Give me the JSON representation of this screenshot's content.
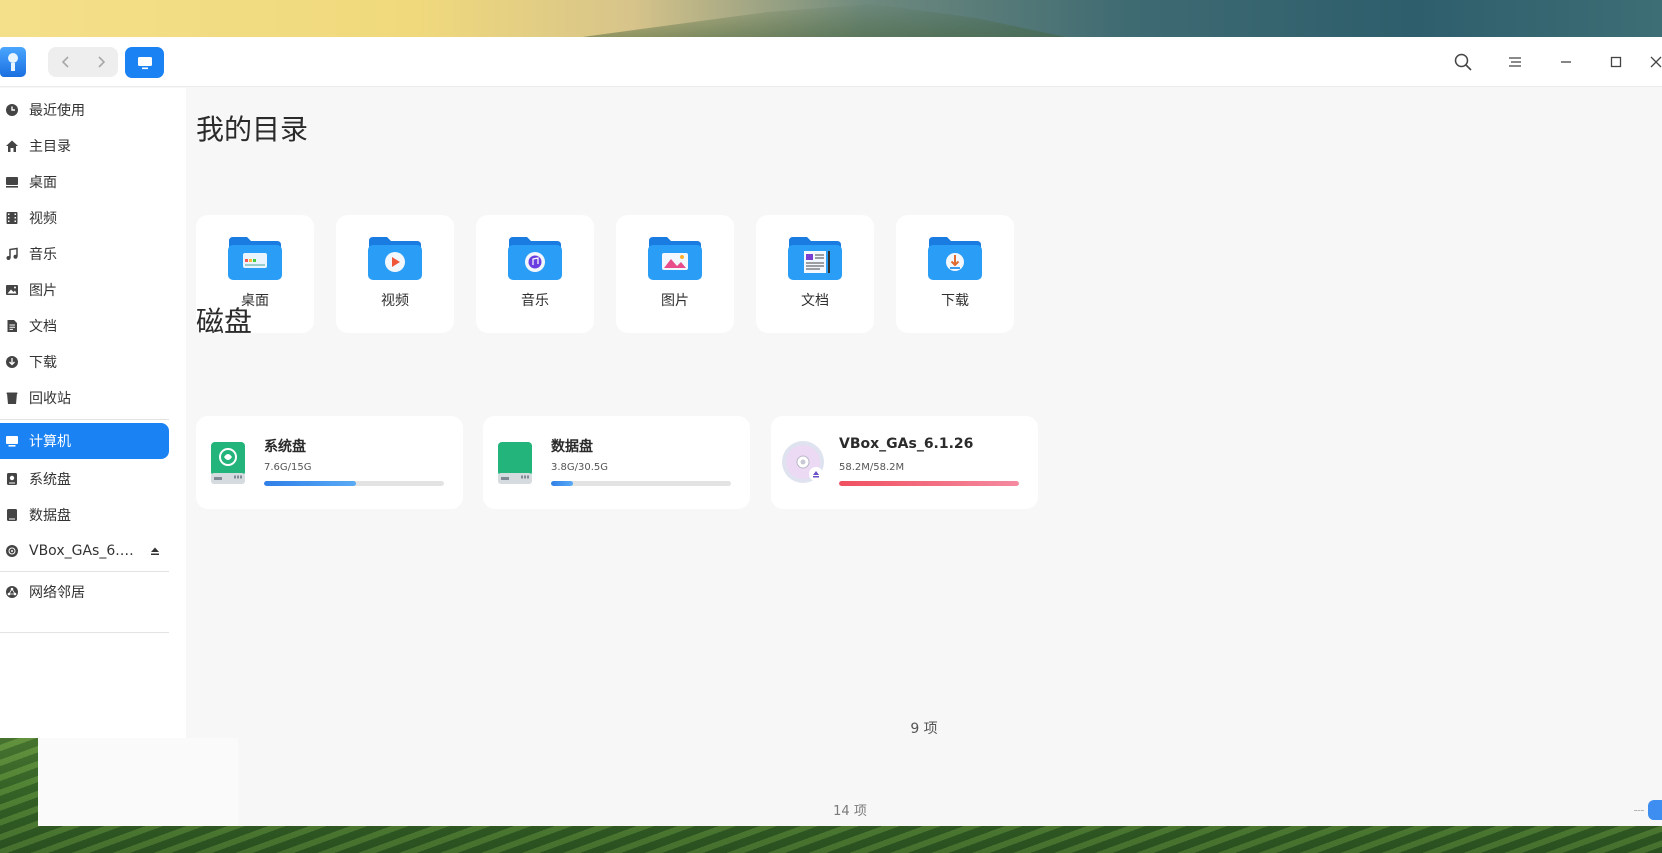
{
  "window": {
    "icons": {
      "app": "file-manager-icon",
      "back": "chevron-left-icon",
      "forward": "chevron-right-icon",
      "view": "computer-icon",
      "search": "search-icon",
      "menu": "menu-icon",
      "minimize": "minimize-icon",
      "maximize": "maximize-icon",
      "close": "close-icon"
    }
  },
  "sidebar": {
    "items": [
      {
        "label": "最近使用",
        "icon": "clock-icon"
      },
      {
        "label": "主目录",
        "icon": "home-icon"
      },
      {
        "label": "桌面",
        "icon": "desktop-icon"
      },
      {
        "label": "视频",
        "icon": "film-icon"
      },
      {
        "label": "音乐",
        "icon": "music-icon"
      },
      {
        "label": "图片",
        "icon": "picture-icon"
      },
      {
        "label": "文档",
        "icon": "document-icon"
      },
      {
        "label": "下载",
        "icon": "download-icon"
      },
      {
        "label": "回收站",
        "icon": "trash-icon"
      },
      {
        "label": "计算机",
        "icon": "computer-icon",
        "active": true
      },
      {
        "label": "系统盘",
        "icon": "disk-icon"
      },
      {
        "label": "数据盘",
        "icon": "disk-icon"
      },
      {
        "label": "VBox_GAs_6.1…",
        "icon": "optical-disc-icon",
        "eject": "eject-icon"
      },
      {
        "label": "网络邻居",
        "icon": "network-icon"
      }
    ]
  },
  "main": {
    "my_directories_title": "我的目录",
    "directories": [
      {
        "name": "桌面",
        "icon": "desktop-folder-icon"
      },
      {
        "name": "视频",
        "icon": "video-folder-icon"
      },
      {
        "name": "音乐",
        "icon": "music-folder-icon"
      },
      {
        "name": "图片",
        "icon": "pictures-folder-icon"
      },
      {
        "name": "文档",
        "icon": "documents-folder-icon"
      },
      {
        "name": "下载",
        "icon": "downloads-folder-icon"
      }
    ],
    "disks_title": "磁盘",
    "disks": [
      {
        "name": "系统盘",
        "size": "7.6G/15G",
        "usage": 0.51,
        "color": "#3b8ef0",
        "icon": "system-disk-icon"
      },
      {
        "name": "数据盘",
        "size": "3.8G/30.5G",
        "usage": 0.12,
        "color": "#3b8ef0",
        "icon": "data-disk-icon"
      },
      {
        "name": "VBox_GAs_6.1.26",
        "size": "58.2M/58.2M",
        "usage": 1.0,
        "color": "#f06474",
        "icon": "optical-disc-icon"
      }
    ],
    "item_count": "9 项"
  },
  "background_window": {
    "item_count": "14 项"
  },
  "colors": {
    "accent": "#1b82f3",
    "folder_blue": "#2a95f5",
    "full_disk": "#f06474"
  }
}
